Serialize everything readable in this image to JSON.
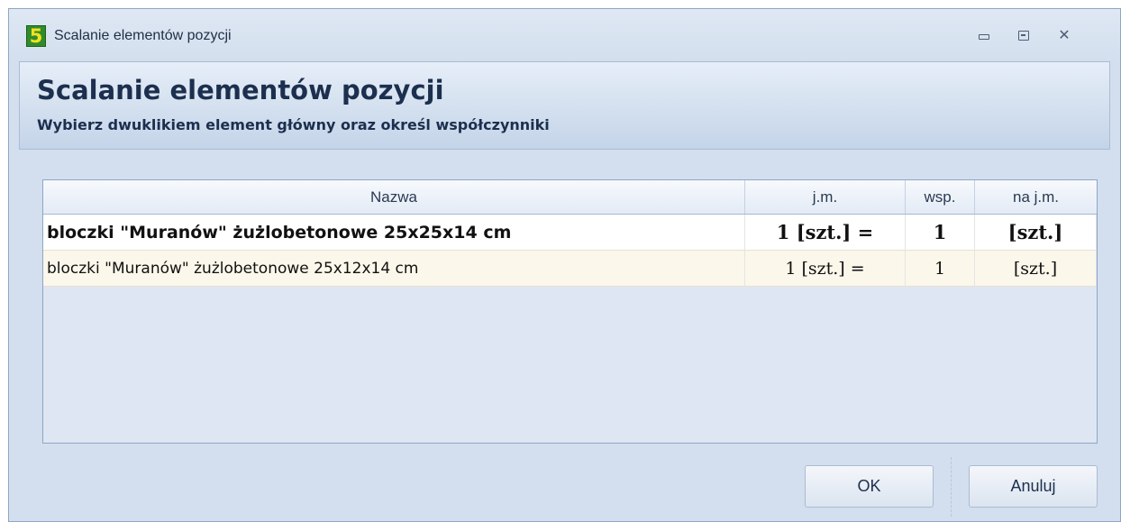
{
  "window": {
    "title": "Scalanie elementów pozycji",
    "app_icon_glyph": "5",
    "controls": [
      "minimize-icon",
      "maximize-icon",
      "close-icon"
    ]
  },
  "header": {
    "title": "Scalanie elementów pozycji",
    "subtitle": "Wybierz dwuklikiem element główny oraz określ współczynniki"
  },
  "grid": {
    "columns": [
      "Nazwa",
      "j.m.",
      "wsp.",
      "na j.m."
    ],
    "rows": [
      {
        "name": "bloczki \"Muranów\" żużlobetonowe 25x25x14 cm",
        "jm": "1 [szt.] =",
        "wsp": "1",
        "na_jm": "[szt.]",
        "main": true
      },
      {
        "name": "bloczki \"Muranów\" żużlobetonowe 25x12x14 cm",
        "jm": "1 [szt.] =",
        "wsp": "1",
        "na_jm": "[szt.]",
        "main": false
      }
    ]
  },
  "buttons": {
    "ok": "OK",
    "cancel": "Anuluj"
  },
  "colors": {
    "window_bg": "#d3dfee",
    "alt_row_bg": "#fbf7eb",
    "icon_green": "#2f8c2a",
    "icon_yellow": "#f2e020"
  }
}
